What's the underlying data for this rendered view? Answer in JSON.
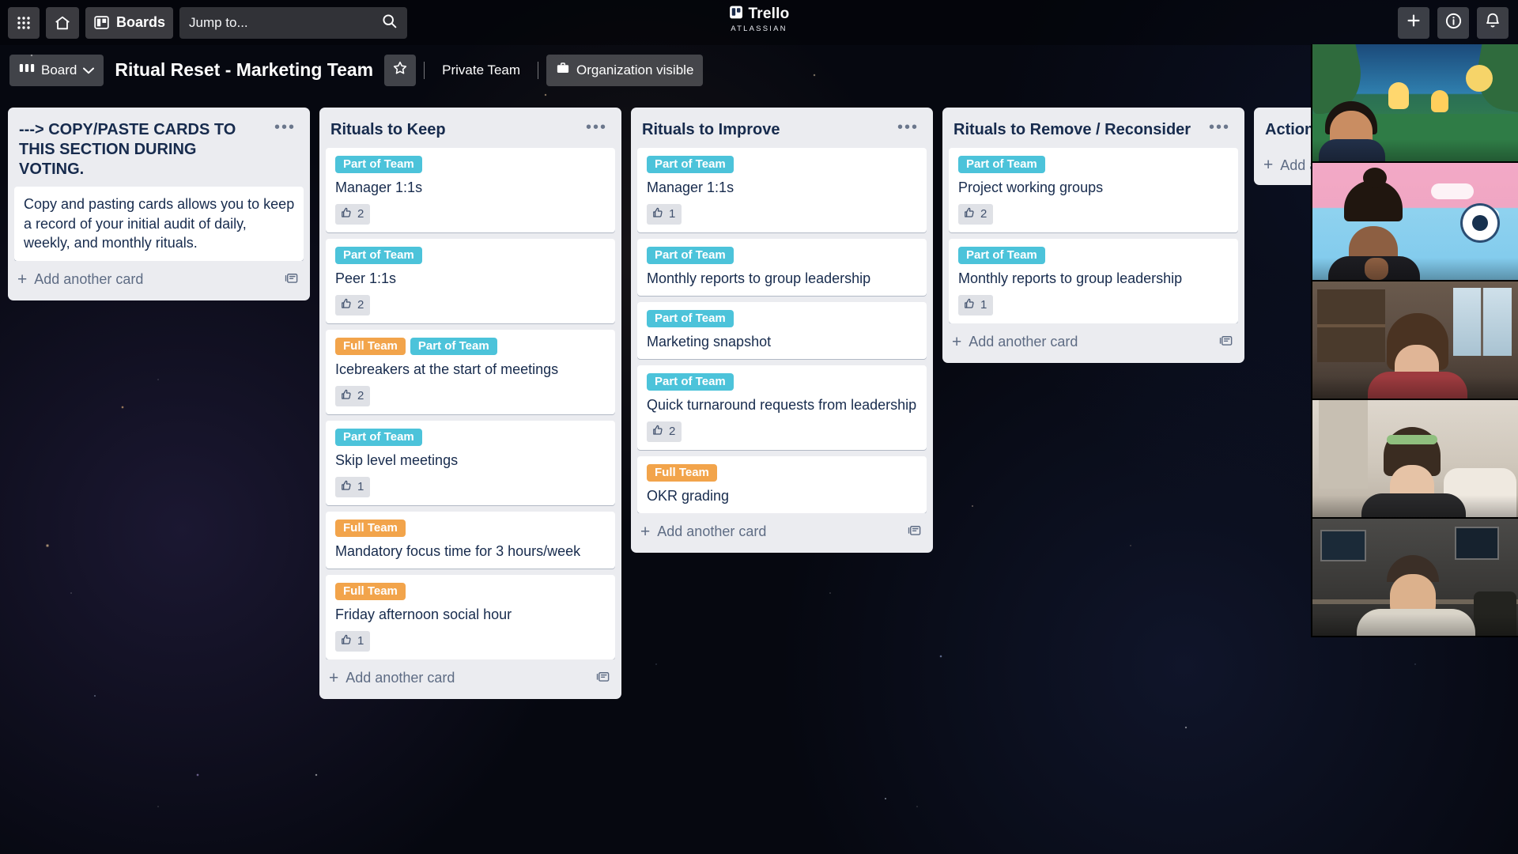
{
  "topnav": {
    "apps_icon": "grid-apps-icon",
    "home_icon": "home-icon",
    "boards_icon": "boards-icon",
    "boards_label": "Boards",
    "search_placeholder": "Jump to...",
    "search_icon": "search-icon",
    "logo_text": "Trello",
    "logo_sub": "ATLASSIAN",
    "logo_icon": "trello-logo-icon",
    "add_icon": "plus-icon",
    "info_icon": "info-icon",
    "notifications_icon": "bell-icon"
  },
  "boardheader": {
    "view_label": "Board",
    "view_icon": "board-view-icon",
    "view_chevron": "chevron-down-icon",
    "title": "Ritual Reset - Marketing Team",
    "star_icon": "star-icon",
    "team_label": "Private Team",
    "visibility_label": "Organization visible",
    "visibility_icon": "briefcase-icon"
  },
  "board": {
    "add_card_label": "Add another card",
    "add_card_plus": "+",
    "template_icon": "card-template-icon",
    "list_menu_icon": "ellipsis-icon",
    "lists": [
      {
        "title": "---> COPY/PASTE CARDS TO THIS SECTION DURING VOTING.",
        "title_is_card": true,
        "cards": [
          {
            "description": "Copy and pasting cards allows you to keep a record of your initial audit of daily, weekly, and monthly rituals.",
            "labels": [],
            "votes": null
          }
        ],
        "show_add_card": true
      },
      {
        "title": "Rituals to Keep",
        "cards": [
          {
            "title": "Manager 1:1s",
            "labels": [
              {
                "text": "Part of Team",
                "color": "teal"
              }
            ],
            "votes": "2"
          },
          {
            "title": "Peer 1:1s",
            "labels": [
              {
                "text": "Part of Team",
                "color": "teal"
              }
            ],
            "votes": "2"
          },
          {
            "title": "Icebreakers at the start of meetings",
            "labels": [
              {
                "text": "Full Team",
                "color": "orange"
              },
              {
                "text": "Part of Team",
                "color": "teal"
              }
            ],
            "votes": "2"
          },
          {
            "title": "Skip level meetings",
            "labels": [
              {
                "text": "Part of Team",
                "color": "teal"
              }
            ],
            "votes": "1"
          },
          {
            "title": "Mandatory focus time for 3 hours/week",
            "labels": [
              {
                "text": "Full Team",
                "color": "orange"
              }
            ],
            "votes": null
          },
          {
            "title": "Friday afternoon social hour",
            "labels": [
              {
                "text": "Full Team",
                "color": "orange"
              }
            ],
            "votes": "1"
          }
        ],
        "show_add_card": true
      },
      {
        "title": "Rituals to Improve",
        "cards": [
          {
            "title": "Manager 1:1s",
            "labels": [
              {
                "text": "Part of Team",
                "color": "teal"
              }
            ],
            "votes": "1"
          },
          {
            "title": "Monthly reports to group leadership",
            "labels": [
              {
                "text": "Part of Team",
                "color": "teal"
              }
            ],
            "votes": null
          },
          {
            "title": "Marketing snapshot",
            "labels": [
              {
                "text": "Part of Team",
                "color": "teal"
              }
            ],
            "votes": null
          },
          {
            "title": "Quick turnaround requests from leadership",
            "labels": [
              {
                "text": "Part of Team",
                "color": "teal"
              }
            ],
            "votes": "2"
          },
          {
            "title": "OKR grading",
            "labels": [
              {
                "text": "Full Team",
                "color": "orange"
              }
            ],
            "votes": null
          }
        ],
        "show_add_card": true
      },
      {
        "title": "Rituals to Remove / Reconsider",
        "cards": [
          {
            "title": "Project working groups",
            "labels": [
              {
                "text": "Part of Team",
                "color": "teal"
              }
            ],
            "votes": "2"
          },
          {
            "title": "Monthly reports to group leadership",
            "labels": [
              {
                "text": "Part of Team",
                "color": "teal"
              }
            ],
            "votes": "1"
          }
        ],
        "show_add_card": true
      },
      {
        "title": "Action Items",
        "cards": [],
        "show_add_card": true
      }
    ]
  },
  "video_call": {
    "participants": [
      {
        "name": "participant-1"
      },
      {
        "name": "participant-2"
      },
      {
        "name": "participant-3"
      },
      {
        "name": "participant-4"
      },
      {
        "name": "participant-5"
      }
    ]
  },
  "colors": {
    "label_teal": "#4cc3da",
    "label_orange": "#f2a44b",
    "list_bg": "#ebecf0",
    "card_bg": "#ffffff",
    "text_primary": "#172b4d",
    "text_muted": "#5e6c84"
  }
}
